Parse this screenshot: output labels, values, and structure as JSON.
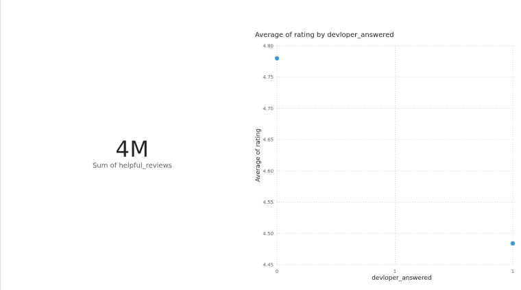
{
  "card": {
    "value": "4M",
    "label": "Sum of helpful_reviews"
  },
  "chart_data": {
    "type": "scatter",
    "title": "Average of rating by devloper_answered",
    "xlabel": "devloper_answered",
    "ylabel": "Average of rating",
    "x_ticks": [
      "0",
      "1",
      "1"
    ],
    "y_ticks": [
      "4.80",
      "4.75",
      "4.70",
      "4.65",
      "4.60",
      "4.55",
      "4.50",
      "4.45"
    ],
    "xlim": [
      0,
      1
    ],
    "ylim": [
      4.45,
      4.8
    ],
    "grid": true,
    "points": [
      {
        "x": 0,
        "y": 4.78
      },
      {
        "x": 1,
        "y": 4.484
      }
    ],
    "colors": {
      "point": "#3599e6",
      "grid": "#c8c6c4",
      "text": "#605e5c"
    }
  }
}
